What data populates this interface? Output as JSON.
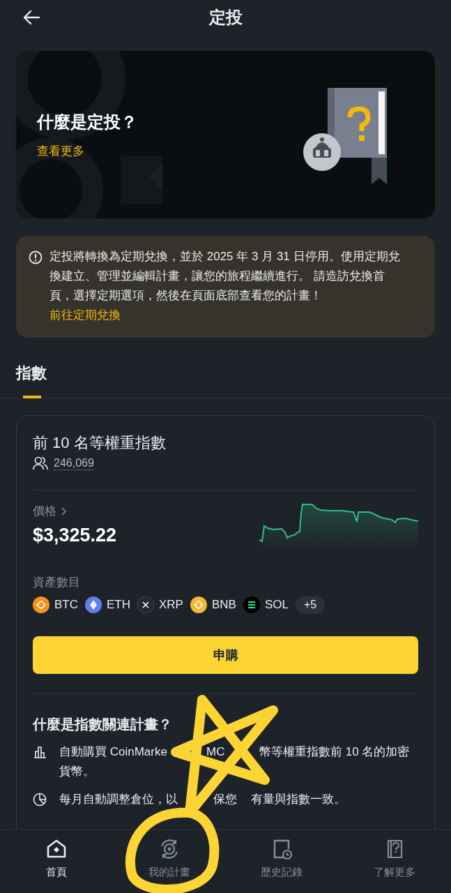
{
  "header": {
    "title": "定投"
  },
  "banner": {
    "title": "什麼是定投？",
    "link": "查看更多"
  },
  "notice": {
    "text": "定投將轉換為定期兌換，並於 2025 年 3 月 31 日停用。使用定期兌換建立、管理並編輯計畫，讓您的旅程繼續進行。 請造訪兌換首頁，選擇定期選項，然後在頁面底部查看您的計畫！",
    "link": "前往定期兌換"
  },
  "tabs": [
    {
      "label": "指數",
      "selected": true
    }
  ],
  "index_card": {
    "title": "前 10 名等權重指數",
    "participants": "246,069",
    "price_label": "價格",
    "price": "$3,325.22",
    "assets_label": "資產數目",
    "coins": [
      {
        "symbol": "BTC",
        "color": "#f7931a"
      },
      {
        "symbol": "ETH",
        "color": "#627eea"
      },
      {
        "symbol": "XRP",
        "color": "#23292f"
      },
      {
        "symbol": "BNB",
        "color": "#f3ba2f"
      },
      {
        "symbol": "SOL",
        "color": "#000000"
      }
    ],
    "more": "+5",
    "button": "申購"
  },
  "info": {
    "title": "什麼是指數關連計畫？",
    "items": [
      {
        "kind": "chart",
        "fragments": [
          "自動購買 CoinMarke",
          "MC",
          "幣等權重指數前 10 名的加密",
          "貨幣。"
        ]
      },
      {
        "kind": "pie",
        "fragments": [
          "每月自動調整倉位，以",
          "保您",
          "有量與指數一致。"
        ]
      }
    ]
  },
  "nav": [
    {
      "label": "首頁",
      "kind": "home",
      "selected": true
    },
    {
      "label": "我的計畫",
      "kind": "plans",
      "selected": false
    },
    {
      "label": "歷史記錄",
      "kind": "history",
      "selected": false
    },
    {
      "label": "了解更多",
      "kind": "learn",
      "selected": false
    }
  ]
}
